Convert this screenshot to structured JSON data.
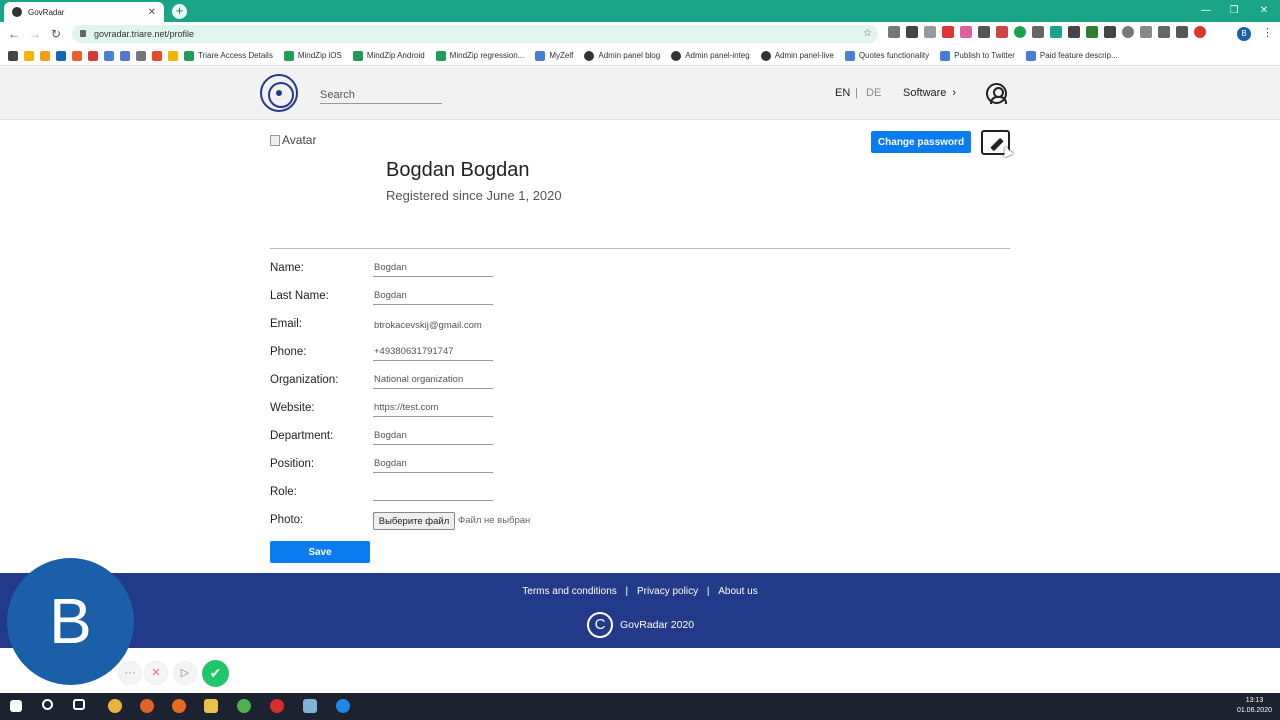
{
  "browser": {
    "tab_title": "GovRadar",
    "url": "govradar.triare.net/profile",
    "profile_initial": "B",
    "win_minimize": "—",
    "win_restore": "❐",
    "win_close": "✕",
    "bookmarks": [
      {
        "label": "Triare Access Details",
        "color": "#1f9d55"
      },
      {
        "label": "MindZip iOS",
        "color": "#1f9d55"
      },
      {
        "label": "MindZip Android",
        "color": "#1f9d55"
      },
      {
        "label": "MindZip regression...",
        "color": "#1f9d55"
      },
      {
        "label": "MyZelf",
        "color": "#4a7fd6"
      },
      {
        "label": "Admin panel blog",
        "color": "#333333"
      },
      {
        "label": "Admin panel-integ",
        "color": "#333333"
      },
      {
        "label": "Admin panel-live",
        "color": "#333333"
      },
      {
        "label": "Quotes functionality",
        "color": "#4a7fd6"
      },
      {
        "label": "Publish to Twitter",
        "color": "#4a7fd6"
      },
      {
        "label": "Paid feature descrip...",
        "color": "#4a7fd6"
      }
    ]
  },
  "header": {
    "search_placeholder": "Search",
    "lang_en": "EN",
    "lang_sep": "|",
    "lang_de": "DE",
    "software": "Software"
  },
  "profile": {
    "avatar_alt": "Avatar",
    "name": "Bogdan Bogdan",
    "registered": "Registered since June 1, 2020",
    "change_password": "Change password"
  },
  "form": {
    "name_label": "Name:",
    "name_value": "Bogdan",
    "last_name_label": "Last Name:",
    "last_name_value": "Bogdan",
    "email_label": "Email:",
    "email_value": "btrokacevskij@gmail.com",
    "phone_label": "Phone:",
    "phone_value": "+49380631791747",
    "organization_label": "Organization:",
    "organization_value": "National organization",
    "website_label": "Website:",
    "website_value": "https://test.com",
    "department_label": "Department:",
    "department_value": "Bogdan",
    "position_label": "Position:",
    "position_value": "Bogdan",
    "role_label": "Role:",
    "role_value": "",
    "photo_label": "Photo:",
    "file_button": "Выберите файл",
    "file_status": "Файл не выбран",
    "save": "Save"
  },
  "footer": {
    "terms": "Terms and conditions",
    "sep": "|",
    "privacy": "Privacy policy",
    "about": "About us",
    "copyright_symbol": "C",
    "copyright": "GovRadar 2020"
  },
  "overlay": {
    "avatar_initial": "B",
    "more": "···",
    "cancel": "✕",
    "play": "▷",
    "confirm": "✔"
  },
  "taskbar": {
    "time": "13:13",
    "date": "01.06.2020"
  },
  "colors": {
    "brand_navy": "#233a8a",
    "primary_blue": "#0a7cf0",
    "chrome_green": "#1aa588"
  }
}
